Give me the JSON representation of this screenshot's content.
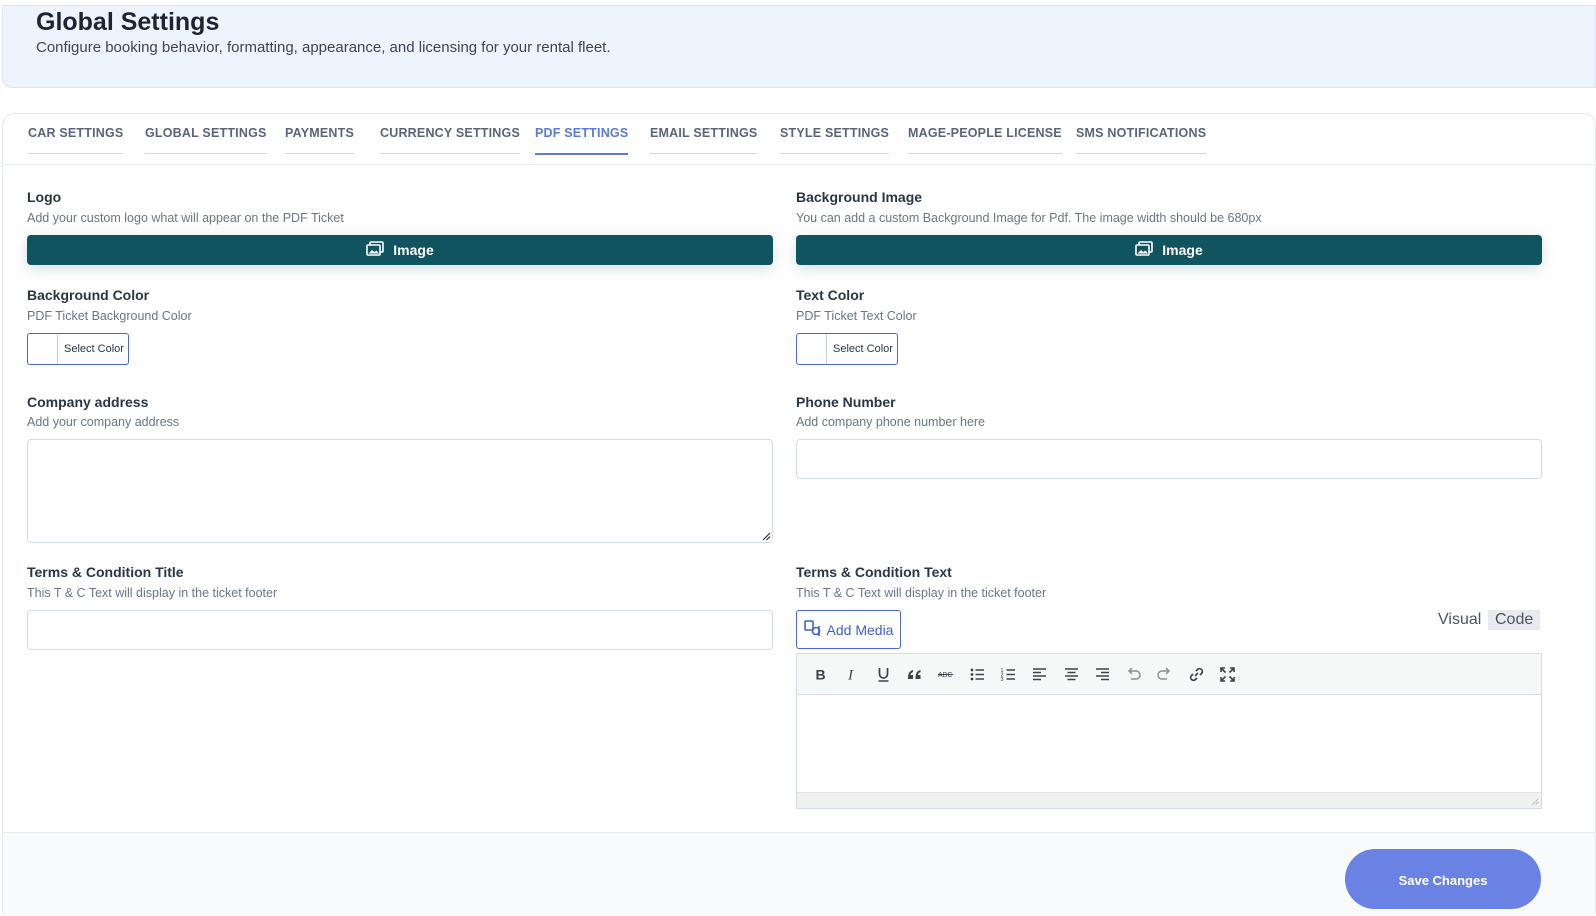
{
  "header": {
    "title": "Global Settings",
    "subtitle": "Configure booking behavior, formatting, appearance, and licensing for your rental fleet."
  },
  "tabs": [
    {
      "label": "CAR SETTINGS",
      "active": false
    },
    {
      "label": "GLOBAL SETTINGS",
      "active": false
    },
    {
      "label": "PAYMENTS",
      "active": false
    },
    {
      "label": "CURRENCY SETTINGS",
      "active": false
    },
    {
      "label": "PDF SETTINGS",
      "active": true
    },
    {
      "label": "EMAIL SETTINGS",
      "active": false
    },
    {
      "label": "STYLE SETTINGS",
      "active": false
    },
    {
      "label": "MAGE-PEOPLE LICENSE",
      "active": false
    },
    {
      "label": "SMS NOTIFICATIONS",
      "active": false
    }
  ],
  "fields": {
    "logo": {
      "label": "Logo",
      "desc": "Add your custom logo what will appear on the PDF Ticket",
      "button": "Image"
    },
    "bg_image": {
      "label": "Background Image",
      "desc": "You can add a custom Background Image for Pdf. The image width should be 680px",
      "button": "Image"
    },
    "bg_color": {
      "label": "Background Color",
      "desc": "PDF Ticket Background Color",
      "button": "Select Color",
      "value": "#ffffff"
    },
    "text_color": {
      "label": "Text Color",
      "desc": "PDF Ticket Text Color",
      "button": "Select Color",
      "value": "#ffffff"
    },
    "company_address": {
      "label": "Company address",
      "desc": "Add your company address",
      "value": ""
    },
    "phone": {
      "label": "Phone Number",
      "desc": "Add company phone number here",
      "value": ""
    },
    "tc_title": {
      "label": "Terms & Condition Title",
      "desc": "This T & C Text will display in the ticket footer",
      "value": ""
    },
    "tc_text": {
      "label": "Terms & Condition Text",
      "desc": "This T & C Text will display in the ticket footer",
      "value": ""
    }
  },
  "editor": {
    "add_media": "Add Media",
    "mode_visual": "Visual",
    "mode_code": "Code",
    "toolbar_icons": [
      "bold-icon",
      "italic-icon",
      "underline-icon",
      "blockquote-icon",
      "strikethrough-icon",
      "bullet-list-icon",
      "numbered-list-icon",
      "align-left-icon",
      "align-center-icon",
      "align-right-icon",
      "undo-icon",
      "redo-icon",
      "link-icon",
      "fullscreen-icon"
    ]
  },
  "footer": {
    "save_label": "Save Changes"
  },
  "colors": {
    "accent": "#5b79d9",
    "image_button": "#105460",
    "save_button": "#6a82e4",
    "header_bg": "#eef4fd"
  }
}
